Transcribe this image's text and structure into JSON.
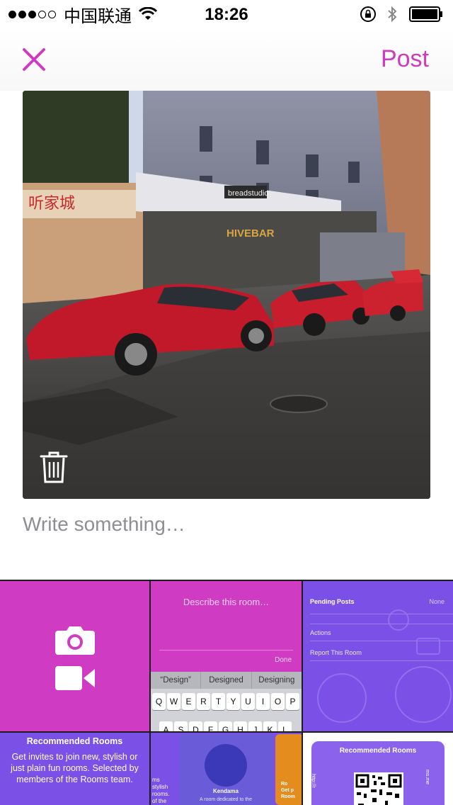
{
  "status_bar": {
    "carrier": "中国联通",
    "time": "18:26",
    "signal_dots_filled": 3,
    "signal_dots_total": 5,
    "icons": [
      "wifi-icon",
      "rotation-lock-icon",
      "bluetooth-icon",
      "battery-icon"
    ]
  },
  "nav": {
    "close_icon": "close-icon",
    "post_label": "Post"
  },
  "photo": {
    "sign_left": "听家城",
    "sign_bakery": "breadstudio",
    "sign_bar": "HIVEBAR",
    "delete_icon": "trash-icon"
  },
  "compose": {
    "placeholder": "Write something…",
    "value": ""
  },
  "media": {
    "camera_icon": "camera-icon",
    "video_icon": "video-icon",
    "describe": {
      "prompt": "Describe this room…",
      "done": "Done",
      "suggestions": [
        "“Design”",
        "Designed",
        "Designing"
      ],
      "keyboard_row1": [
        "Q",
        "W",
        "E",
        "R",
        "T",
        "Y",
        "U",
        "I",
        "O",
        "P"
      ],
      "keyboard_row2": [
        "A",
        "S",
        "D",
        "F",
        "G",
        "H",
        "J",
        "K",
        "L"
      ]
    },
    "settings": {
      "title": "Pending Posts",
      "value": "None",
      "item1": "Actions",
      "item2": "Report This Room"
    },
    "recommended": {
      "title": "Recommended Rooms",
      "body": "Get invites to join new, stylish or just plain fun rooms. Selected by members of the Rooms team."
    },
    "kendama": {
      "left_text": "ms\nstylish\nrooms.\nof the",
      "name": "Kendama",
      "desc": "A room dedicated to the",
      "right_text": "Ro\nGet p\nRoom"
    },
    "qr": {
      "title": "Recommended Rooms",
      "side_left": "http://r",
      "side_right": "ms.me"
    }
  },
  "colors": {
    "accent": "#cf3bbd",
    "magenta_tile": "#cf3bc3",
    "purple_tile": "#7a50e6"
  }
}
